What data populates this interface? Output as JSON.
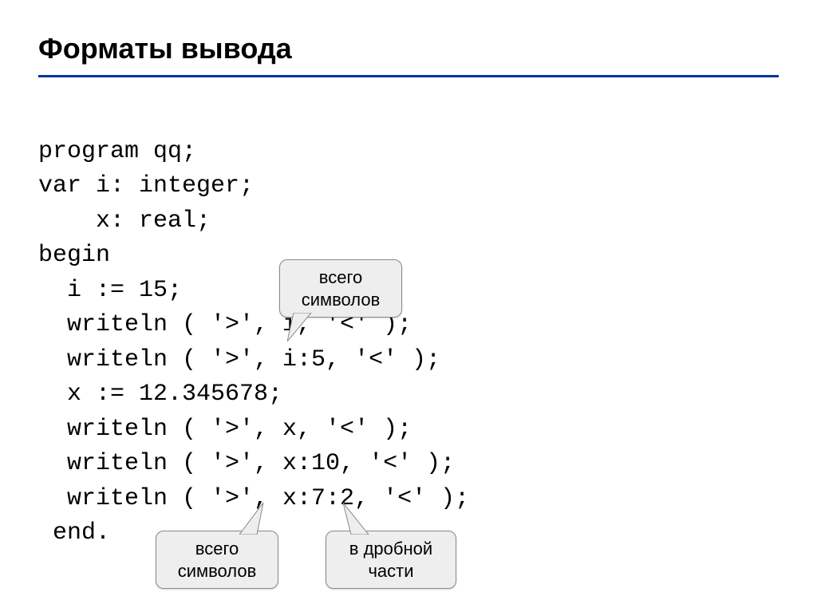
{
  "title": "Форматы вывода",
  "code": {
    "l1": "program qq;",
    "l2": "var i: integer;",
    "l3": "    x: real;",
    "l4": "begin",
    "l5": "  i := 15;",
    "l6": "  writeln ( '>', i, '<' );",
    "l7": "  writeln ( '>', i:5, '<' );",
    "l8": "  x := 12.345678;",
    "l9": "  writeln ( '>', x, '<' );",
    "l10": "  writeln ( '>', x:10, '<' );",
    "l11": "  writeln ( '>', x:7:2, '<' );",
    "l12": " end."
  },
  "callouts": {
    "top": {
      "line1": "всего",
      "line2": "символов"
    },
    "left": {
      "line1": "всего",
      "line2": "символов"
    },
    "right": {
      "line1": "в дробной",
      "line2": "части"
    }
  }
}
